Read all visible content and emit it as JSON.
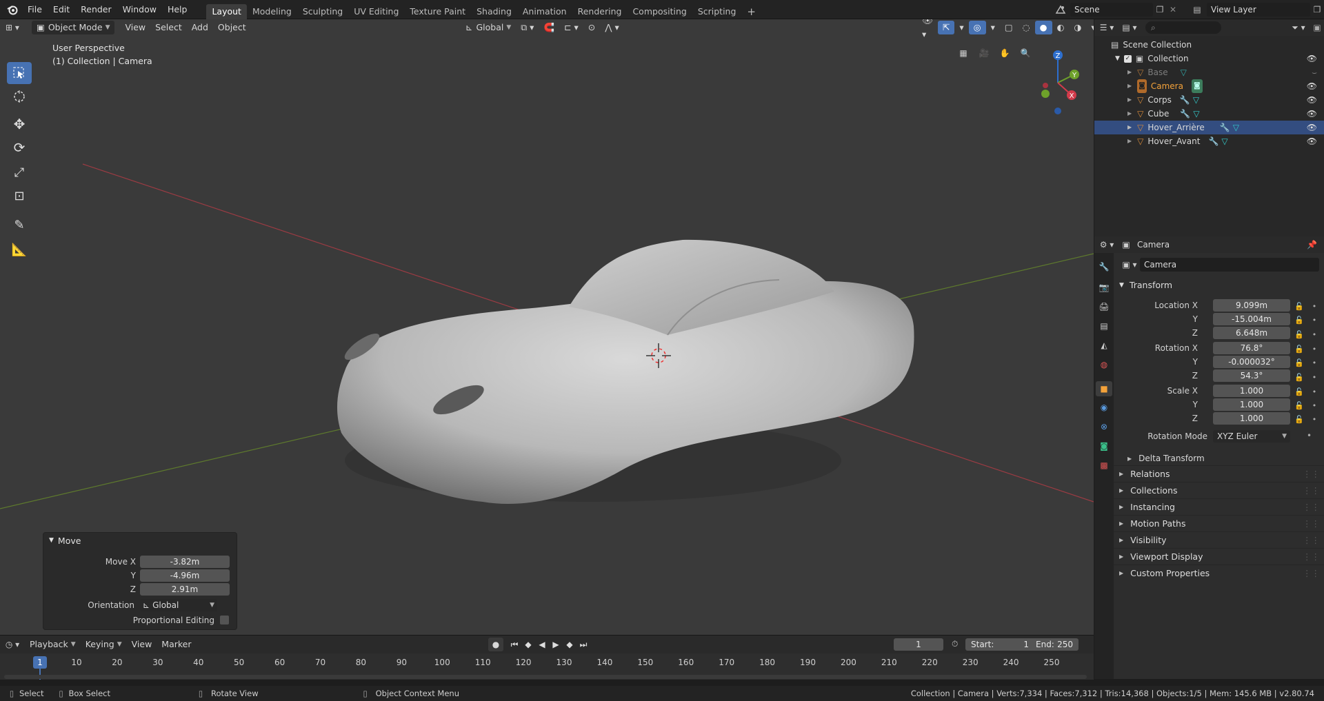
{
  "topbar": {
    "menus": [
      "File",
      "Edit",
      "Render",
      "Window",
      "Help"
    ],
    "workspaces": [
      "Layout",
      "Modeling",
      "Sculpting",
      "UV Editing",
      "Texture Paint",
      "Shading",
      "Animation",
      "Rendering",
      "Compositing",
      "Scripting"
    ],
    "active_workspace": "Layout",
    "add_workspace": "+",
    "scene": "Scene",
    "view_layer": "View Layer"
  },
  "viewport": {
    "mode": "Object Mode",
    "menus": [
      "View",
      "Select",
      "Add",
      "Object"
    ],
    "orientation": "Global",
    "perspective_label": "User Perspective",
    "collection_label": "(1) Collection | Camera",
    "gizmo": {
      "x": "X",
      "y": "Y",
      "z": "Z"
    }
  },
  "operator_panel": {
    "title": "Move",
    "move_x_label": "Move X",
    "move_x": "-3.82m",
    "y_label": "Y",
    "move_y": "-4.96m",
    "z_label": "Z",
    "move_z": "2.91m",
    "orientation_label": "Orientation",
    "orientation": "Global",
    "proportional_label": "Proportional Editing"
  },
  "outliner": {
    "scene_collection": "Scene Collection",
    "collection": "Collection",
    "items": [
      {
        "name": "Base",
        "dimmed": true,
        "selected": false
      },
      {
        "name": "Camera",
        "dimmed": false,
        "selected": false,
        "active": true
      },
      {
        "name": "Corps",
        "dimmed": false,
        "selected": false
      },
      {
        "name": "Cube",
        "dimmed": false,
        "selected": false
      },
      {
        "name": "Hover_Arrière",
        "dimmed": false,
        "selected": true
      },
      {
        "name": "Hover_Avant",
        "dimmed": false,
        "selected": false
      }
    ]
  },
  "properties": {
    "header_object": "Camera",
    "object_name": "Camera",
    "transform_title": "Transform",
    "location_label": "Location X",
    "location": [
      "9.099m",
      "-15.004m",
      "6.648m"
    ],
    "rotation_label": "Rotation X",
    "rotation": [
      "76.8°",
      "-0.000032°",
      "54.3°"
    ],
    "scale_label": "Scale X",
    "scale": [
      "1.000",
      "1.000",
      "1.000"
    ],
    "y_label": "Y",
    "z_label": "Z",
    "rotation_mode_label": "Rotation Mode",
    "rotation_mode": "XYZ Euler",
    "delta_transform": "Delta Transform",
    "sections": [
      "Relations",
      "Collections",
      "Instancing",
      "Motion Paths",
      "Visibility",
      "Viewport Display",
      "Custom Properties"
    ]
  },
  "timeline": {
    "menus": [
      "Playback",
      "Keying",
      "View",
      "Marker"
    ],
    "current_frame": "1",
    "start_label": "Start:",
    "start": "1",
    "end_label": "End:",
    "end": "250",
    "ticks": [
      "10",
      "20",
      "30",
      "40",
      "50",
      "60",
      "70",
      "80",
      "90",
      "100",
      "110",
      "120",
      "130",
      "140",
      "150",
      "160",
      "170",
      "180",
      "190",
      "200",
      "210",
      "220",
      "230",
      "240",
      "250"
    ],
    "playhead": "1"
  },
  "statusbar": {
    "select": "Select",
    "box_select": "Box Select",
    "rotate_view": "Rotate View",
    "context_menu": "Object Context Menu",
    "stats": "Collection | Camera | Verts:7,334 | Faces:7,312 | Tris:14,368 | Objects:1/5 | Mem: 145.6 MB | v2.80.74"
  },
  "colors": {
    "accent": "#4772b3",
    "selected_row": "#334d80",
    "viewport_bg": "#3a3a3a",
    "active_orange": "#f4a23a"
  }
}
